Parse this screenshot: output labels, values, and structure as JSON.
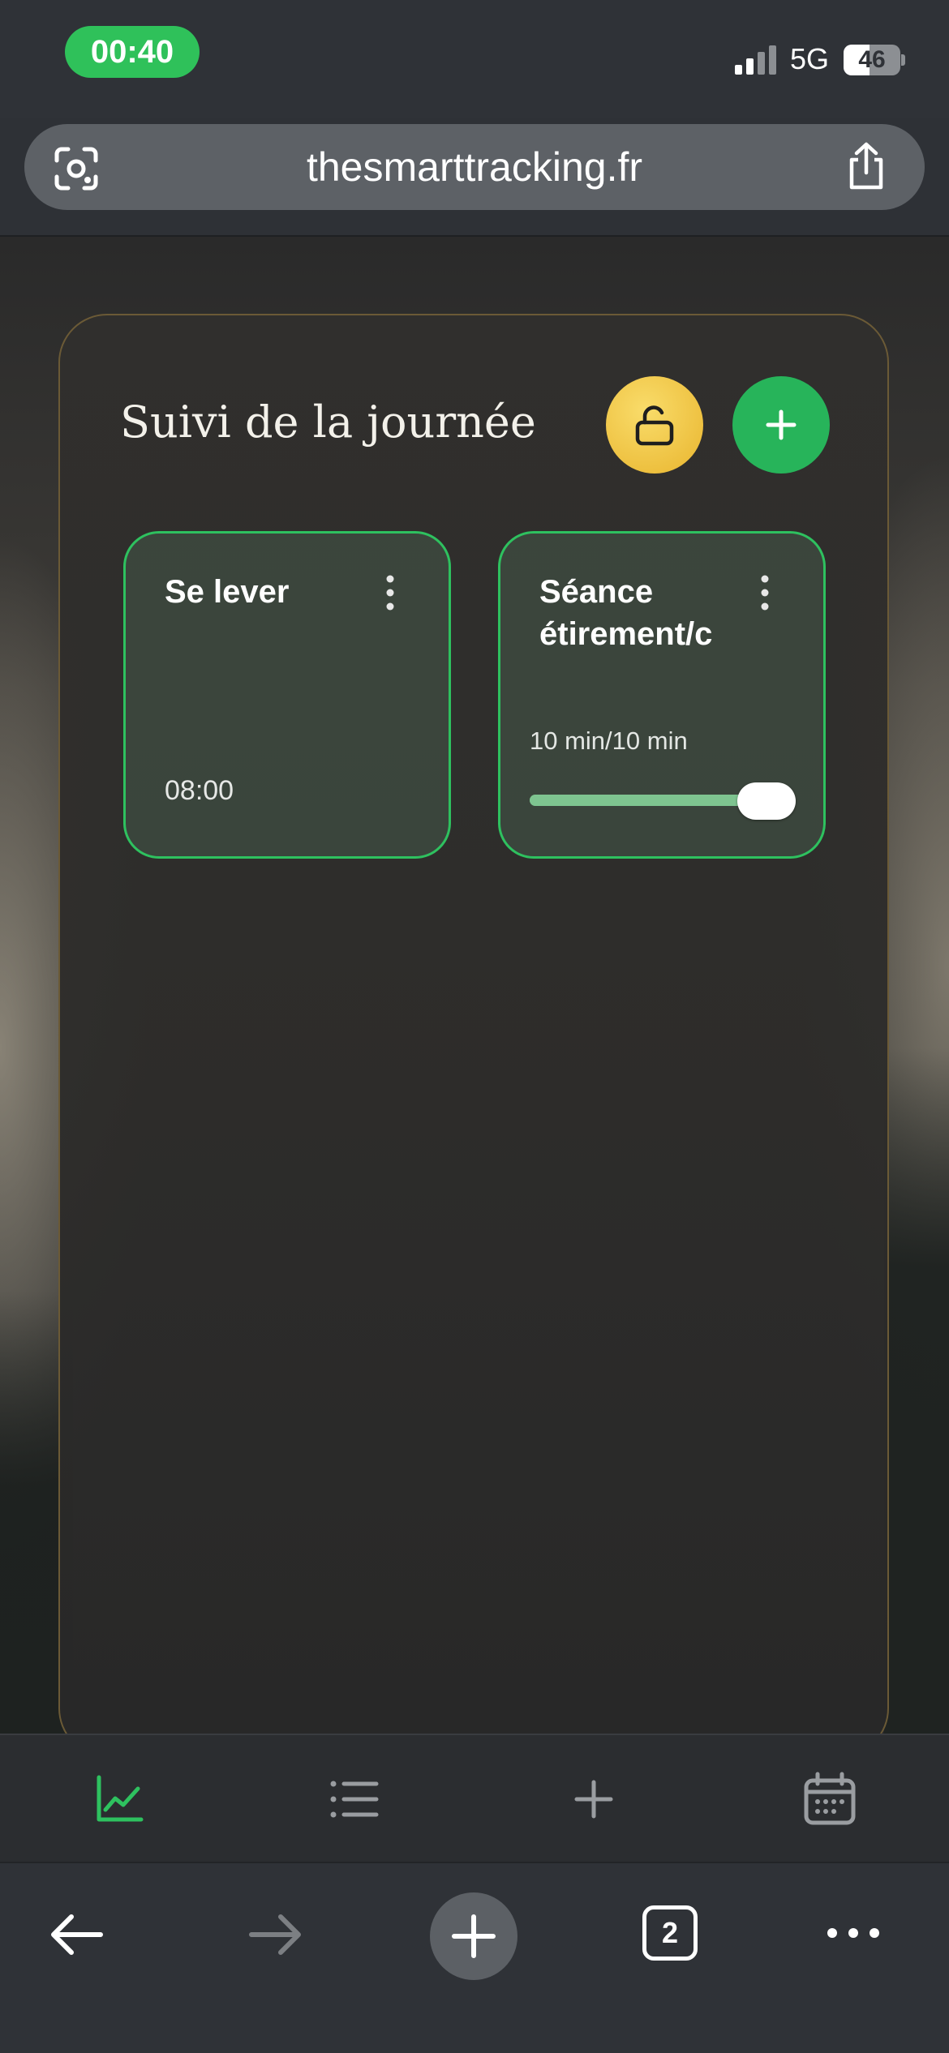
{
  "status_bar": {
    "time": "00:40",
    "network": "5G",
    "battery": "46"
  },
  "browser": {
    "url": "thesmarttracking.fr",
    "tab_count": "2"
  },
  "panel": {
    "title": "Suivi de la journée"
  },
  "cards": [
    {
      "title": "Se lever",
      "time": "08:00"
    },
    {
      "title": "Séance étirement/c",
      "progress_text": "10 min/10 min",
      "progress_fraction": 1.0
    }
  ],
  "colors": {
    "accent_green": "#27b45a",
    "lock_yellow": "#f1c84a",
    "card_border": "#2ec15f"
  },
  "icons": {
    "nav": [
      "chart-line-icon",
      "list-icon",
      "plus-icon",
      "calendar-icon"
    ],
    "toolbar": [
      "back-arrow-icon",
      "forward-arrow-icon",
      "new-tab-plus-icon",
      "tabs-icon",
      "more-icon"
    ]
  }
}
